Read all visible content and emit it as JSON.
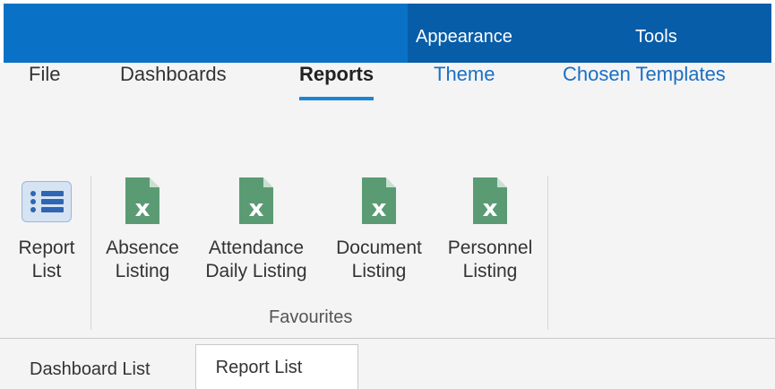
{
  "title_bar": {
    "sections": [
      {
        "label": "Appearance"
      },
      {
        "label": "Tools"
      }
    ]
  },
  "ribbon": {
    "tabs": [
      {
        "label": "File"
      },
      {
        "label": "Dashboards"
      },
      {
        "label": "Reports",
        "selected": true
      },
      {
        "label": "Theme"
      },
      {
        "label": "Chosen Templates"
      }
    ],
    "commands": [
      {
        "label_line1": "Report",
        "label_line2": "List",
        "icon": "report-list-icon"
      },
      {
        "label_line1": "Absence",
        "label_line2": "Listing",
        "icon": "excel-icon"
      },
      {
        "label_line1": "Attendance",
        "label_line2": "Daily Listing",
        "icon": "excel-icon"
      },
      {
        "label_line1": "Document",
        "label_line2": "Listing",
        "icon": "excel-icon"
      },
      {
        "label_line1": "Personnel",
        "label_line2": "Listing",
        "icon": "excel-icon"
      }
    ],
    "group_label": "Favourites"
  },
  "document_tabs": [
    {
      "label": "Dashboard List"
    },
    {
      "label": "Report List",
      "selected": true
    }
  ],
  "colors": {
    "top_bar": "#0a72c6",
    "top_bar_section": "#085da8",
    "accent": "#1b86d8",
    "excel_green": "#5b9b73"
  }
}
